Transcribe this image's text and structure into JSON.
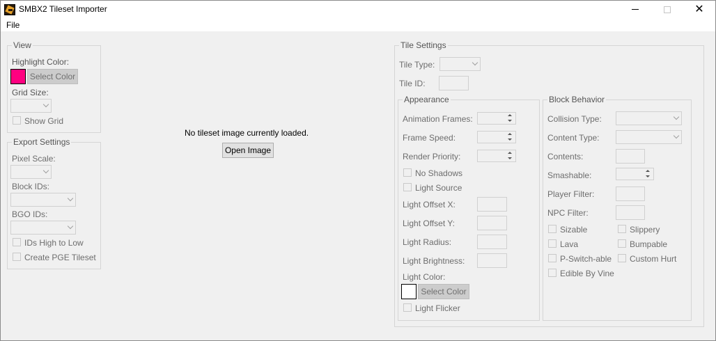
{
  "window": {
    "title": "SMBX2 Tileset Importer",
    "minimize": "–",
    "close": "✕"
  },
  "menu": {
    "file": "File"
  },
  "view": {
    "legend": "View",
    "highlight_color": "Highlight Color:",
    "highlight_swatch": "#ff0080",
    "select_color": "Select Color",
    "grid_size": "Grid Size:",
    "show_grid": "Show Grid"
  },
  "export": {
    "legend": "Export Settings",
    "pixel_scale": "Pixel Scale:",
    "block_ids": "Block IDs:",
    "bgo_ids": "BGO IDs:",
    "ids_high_low": "IDs High to Low",
    "create_pge": "Create PGE Tileset"
  },
  "canvas": {
    "message": "No tileset image currently loaded.",
    "open_image": "Open Image"
  },
  "tile": {
    "legend": "Tile Settings",
    "tile_type": "Tile Type:",
    "tile_id": "Tile ID:"
  },
  "appearance": {
    "legend": "Appearance",
    "animation_frames": "Animation Frames:",
    "frame_speed": "Frame Speed:",
    "render_priority": "Render Priority:",
    "no_shadows": "No Shadows",
    "light_source": "Light Source",
    "light_offset_x": "Light Offset X:",
    "light_offset_y": "Light Offset Y:",
    "light_radius": "Light Radius:",
    "light_brightness": "Light Brightness:",
    "light_color": "Light Color:",
    "light_swatch": "#ffffff",
    "select_color": "Select Color",
    "light_flicker": "Light Flicker"
  },
  "behavior": {
    "legend": "Block Behavior",
    "collision_type": "Collision Type:",
    "content_type": "Content Type:",
    "contents": "Contents:",
    "smashable": "Smashable:",
    "player_filter": "Player Filter:",
    "npc_filter": "NPC Filter:",
    "sizable": "Sizable",
    "slippery": "Slippery",
    "lava": "Lava",
    "bumpable": "Bumpable",
    "p_switch": "P-Switch-able",
    "custom_hurt": "Custom Hurt",
    "edible_vine": "Edible By Vine"
  }
}
